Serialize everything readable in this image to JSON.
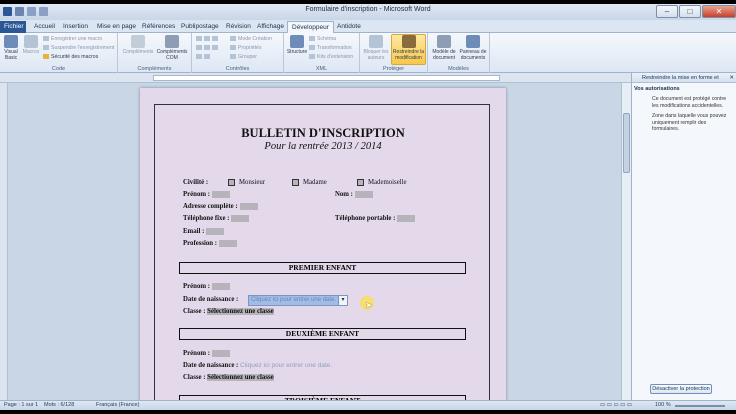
{
  "window": {
    "title": "Formulaire d'inscription - Microsoft Word"
  },
  "tabs": [
    {
      "label": "Fichier"
    },
    {
      "label": "Accueil"
    },
    {
      "label": "Insertion"
    },
    {
      "label": "Mise en page"
    },
    {
      "label": "Références"
    },
    {
      "label": "Publipostage"
    },
    {
      "label": "Révision"
    },
    {
      "label": "Affichage"
    },
    {
      "label": "Développeur"
    },
    {
      "label": "Antidote"
    }
  ],
  "ribbon": {
    "code": {
      "label": "Code",
      "visual_basic": "Visual Basic",
      "macros": "Macros",
      "record": "Enregistrer une macro",
      "pause": "Suspendre l'enregistrement",
      "security": "Sécurité des macros"
    },
    "complements": {
      "label": "Compléments",
      "complements": "Compléments",
      "com": "Compléments COM"
    },
    "controles": {
      "label": "Contrôles",
      "design_mode": "Mode Création",
      "properties": "Propriétés",
      "group": "Grouper"
    },
    "xml": {
      "label": "XML",
      "structure": "Structure",
      "schema": "Schéma",
      "transformation": "Transformation",
      "kits": "Kits d'extension"
    },
    "protect": {
      "label": "Protéger",
      "block": "Bloquer les auteurs",
      "restrict": "Restreindre la modification"
    },
    "modeles": {
      "label": "Modèles",
      "template": "Modèle de document",
      "panel": "Panneau de documents"
    }
  },
  "document": {
    "title": "BULLETIN D'INSCRIPTION",
    "subtitle": "Pour la rentrée 2013 / 2014",
    "civility_label": "Civilité :",
    "civility_options": [
      "Monsieur",
      "Madame",
      "Mademoiselle"
    ],
    "prenom": "Prénom :",
    "nom": "Nom :",
    "adresse": "Adresse complète :",
    "tel_fixe": "Téléphone fixe :",
    "tel_portable": "Téléphone portable :",
    "email": "Email :",
    "profession": "Profession :",
    "section1": "PREMIER ENFANT",
    "section2": "DEUXIÈME ENFANT",
    "section3": "TROISIÈME ENFANT",
    "child_prenom": "Prénom :",
    "child_birth": "Date de naissance :",
    "date_placeholder": "Cliquez ici pour entrer une date.",
    "child_class": "Classe :",
    "class_select": "Sélectionnez une classe"
  },
  "task_pane": {
    "title": "Restreindre la mise en forme et",
    "section": "Vos autorisations",
    "msg1": "Ce document est protégé contre les modifications accidentelles.",
    "msg2": "Zone dans laquelle vous pouvez uniquement remplir des formulaires.",
    "button": "Désactiver la protection"
  },
  "status": {
    "page": "Page : 1 sur 1",
    "words": "Mots : 6/128",
    "language": "Français (France)",
    "zoom": "100 %"
  }
}
